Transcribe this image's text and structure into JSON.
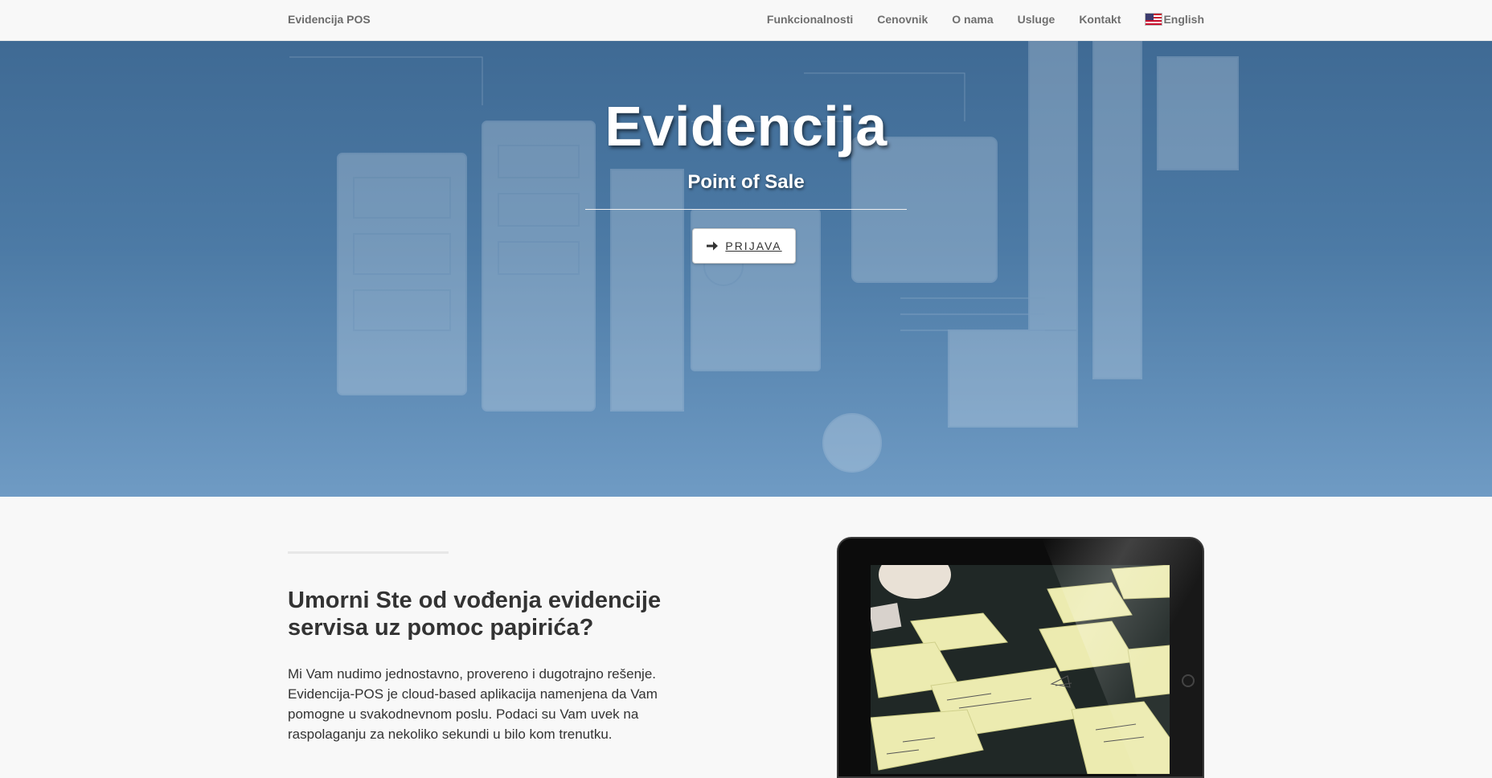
{
  "navbar": {
    "brand": "Evidencija POS",
    "items": [
      {
        "label": "Funkcionalnosti"
      },
      {
        "label": "Cenovnik"
      },
      {
        "label": "O nama"
      },
      {
        "label": "Usluge"
      },
      {
        "label": "Kontakt"
      }
    ],
    "language": {
      "label": "English",
      "icon": "us-flag-icon"
    }
  },
  "hero": {
    "title": "Evidencija",
    "subtitle": "Point of Sale",
    "login_button": {
      "label": "PRIJAVA",
      "icon": "arrow-right-icon"
    }
  },
  "intro": {
    "heading": "Umorni Ste od vođenja evidencije servisa uz pomoc papirića?",
    "text": "Mi Vam nudimo jednostavno, provereno i dugotrajno rešenje. Evidencija-POS je cloud-based aplikacija namenjena da Vam pomogne u svakodnevnom poslu. Podaci su Vam uvek na raspolaganju za nekoliko sekundi u bilo kom trenutku."
  },
  "colors": {
    "hero_top": "#3f6a94",
    "hero_bottom": "#6f9bc4",
    "navbar_bg": "#f8f8f8",
    "text": "#333333"
  }
}
